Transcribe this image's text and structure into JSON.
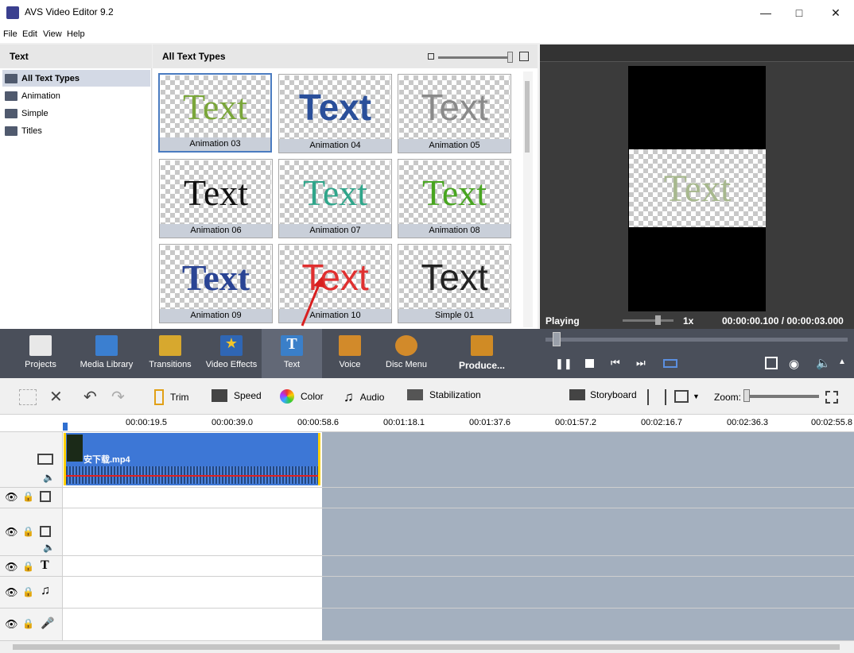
{
  "window": {
    "title": "AVS Video Editor 9.2"
  },
  "menu": [
    "File",
    "Edit",
    "View",
    "Help"
  ],
  "categories": {
    "header": "Text",
    "items": [
      "All Text Types",
      "Animation",
      "Simple",
      "Titles"
    ],
    "selected": "All Text Types"
  },
  "grid": {
    "header": "All Text Types",
    "sample_text": "Text",
    "items": [
      {
        "label": "Animation 03",
        "color": "#7aa63a"
      },
      {
        "label": "Animation 04",
        "color": "#2a4f9a"
      },
      {
        "label": "Animation 05",
        "color": "#8a8a8a"
      },
      {
        "label": "Animation 06",
        "color": "#111111"
      },
      {
        "label": "Animation 07",
        "color": "#2fa58a"
      },
      {
        "label": "Animation 08",
        "color": "#48a520"
      },
      {
        "label": "Animation 09",
        "color": "#2a4494"
      },
      {
        "label": "Animation 10",
        "color": "#e03030"
      },
      {
        "label": "Simple 01",
        "color": "#222222"
      }
    ]
  },
  "preview": {
    "status": "Playing",
    "speed": "1x",
    "current_time": "00:00:00.100",
    "separator": "/",
    "total_time": "00:00:03.000",
    "sample_text": "Text"
  },
  "tools": [
    {
      "label": "Projects",
      "icon": "clapperboard-icon",
      "color": "#e8e8e8"
    },
    {
      "label": "Media Library",
      "icon": "film-icon",
      "color": "#3b7fd0"
    },
    {
      "label": "Transitions",
      "icon": "transitions-icon",
      "color": "#d7a82e"
    },
    {
      "label": "Video Effects",
      "icon": "star-icon",
      "color": "#2f66b4"
    },
    {
      "label": "Text",
      "icon": "text-icon",
      "color": "#3a7fc9",
      "active": true
    },
    {
      "label": "Voice",
      "icon": "microphone-icon",
      "color": "#d28a2a"
    },
    {
      "label": "Disc Menu",
      "icon": "disc-icon",
      "color": "#d28a2a"
    },
    {
      "label": "Produce...",
      "icon": "produce-icon",
      "color": "#d08b25"
    }
  ],
  "edit_toolbar": {
    "trim": "Trim",
    "speed": "Speed",
    "color": "Color",
    "audio": "Audio",
    "stabilization": "Stabilization",
    "storyboard": "Storyboard",
    "zoom": "Zoom:"
  },
  "ruler": [
    "00:00:19.5",
    "00:00:39.0",
    "00:00:58.6",
    "00:01:18.1",
    "00:01:37.6",
    "00:01:57.2",
    "00:02:16.7",
    "00:02:36.3",
    "00:02:55.8"
  ],
  "clip": {
    "name": "安下载.mp4"
  }
}
